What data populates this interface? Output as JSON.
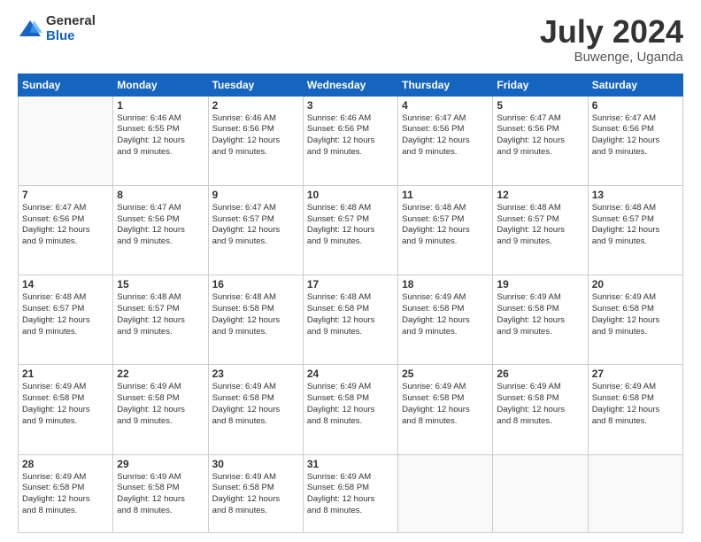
{
  "logo": {
    "general": "General",
    "blue": "Blue"
  },
  "header": {
    "month_year": "July 2024",
    "location": "Buwenge, Uganda"
  },
  "weekdays": [
    "Sunday",
    "Monday",
    "Tuesday",
    "Wednesday",
    "Thursday",
    "Friday",
    "Saturday"
  ],
  "weeks": [
    [
      {
        "day": "",
        "text": ""
      },
      {
        "day": "1",
        "text": "Sunrise: 6:46 AM\nSunset: 6:55 PM\nDaylight: 12 hours\nand 9 minutes."
      },
      {
        "day": "2",
        "text": "Sunrise: 6:46 AM\nSunset: 6:56 PM\nDaylight: 12 hours\nand 9 minutes."
      },
      {
        "day": "3",
        "text": "Sunrise: 6:46 AM\nSunset: 6:56 PM\nDaylight: 12 hours\nand 9 minutes."
      },
      {
        "day": "4",
        "text": "Sunrise: 6:47 AM\nSunset: 6:56 PM\nDaylight: 12 hours\nand 9 minutes."
      },
      {
        "day": "5",
        "text": "Sunrise: 6:47 AM\nSunset: 6:56 PM\nDaylight: 12 hours\nand 9 minutes."
      },
      {
        "day": "6",
        "text": "Sunrise: 6:47 AM\nSunset: 6:56 PM\nDaylight: 12 hours\nand 9 minutes."
      }
    ],
    [
      {
        "day": "7",
        "text": "Sunrise: 6:47 AM\nSunset: 6:56 PM\nDaylight: 12 hours\nand 9 minutes."
      },
      {
        "day": "8",
        "text": "Sunrise: 6:47 AM\nSunset: 6:56 PM\nDaylight: 12 hours\nand 9 minutes."
      },
      {
        "day": "9",
        "text": "Sunrise: 6:47 AM\nSunset: 6:57 PM\nDaylight: 12 hours\nand 9 minutes."
      },
      {
        "day": "10",
        "text": "Sunrise: 6:48 AM\nSunset: 6:57 PM\nDaylight: 12 hours\nand 9 minutes."
      },
      {
        "day": "11",
        "text": "Sunrise: 6:48 AM\nSunset: 6:57 PM\nDaylight: 12 hours\nand 9 minutes."
      },
      {
        "day": "12",
        "text": "Sunrise: 6:48 AM\nSunset: 6:57 PM\nDaylight: 12 hours\nand 9 minutes."
      },
      {
        "day": "13",
        "text": "Sunrise: 6:48 AM\nSunset: 6:57 PM\nDaylight: 12 hours\nand 9 minutes."
      }
    ],
    [
      {
        "day": "14",
        "text": "Sunrise: 6:48 AM\nSunset: 6:57 PM\nDaylight: 12 hours\nand 9 minutes."
      },
      {
        "day": "15",
        "text": "Sunrise: 6:48 AM\nSunset: 6:57 PM\nDaylight: 12 hours\nand 9 minutes."
      },
      {
        "day": "16",
        "text": "Sunrise: 6:48 AM\nSunset: 6:58 PM\nDaylight: 12 hours\nand 9 minutes."
      },
      {
        "day": "17",
        "text": "Sunrise: 6:48 AM\nSunset: 6:58 PM\nDaylight: 12 hours\nand 9 minutes."
      },
      {
        "day": "18",
        "text": "Sunrise: 6:49 AM\nSunset: 6:58 PM\nDaylight: 12 hours\nand 9 minutes."
      },
      {
        "day": "19",
        "text": "Sunrise: 6:49 AM\nSunset: 6:58 PM\nDaylight: 12 hours\nand 9 minutes."
      },
      {
        "day": "20",
        "text": "Sunrise: 6:49 AM\nSunset: 6:58 PM\nDaylight: 12 hours\nand 9 minutes."
      }
    ],
    [
      {
        "day": "21",
        "text": "Sunrise: 6:49 AM\nSunset: 6:58 PM\nDaylight: 12 hours\nand 9 minutes."
      },
      {
        "day": "22",
        "text": "Sunrise: 6:49 AM\nSunset: 6:58 PM\nDaylight: 12 hours\nand 9 minutes."
      },
      {
        "day": "23",
        "text": "Sunrise: 6:49 AM\nSunset: 6:58 PM\nDaylight: 12 hours\nand 8 minutes."
      },
      {
        "day": "24",
        "text": "Sunrise: 6:49 AM\nSunset: 6:58 PM\nDaylight: 12 hours\nand 8 minutes."
      },
      {
        "day": "25",
        "text": "Sunrise: 6:49 AM\nSunset: 6:58 PM\nDaylight: 12 hours\nand 8 minutes."
      },
      {
        "day": "26",
        "text": "Sunrise: 6:49 AM\nSunset: 6:58 PM\nDaylight: 12 hours\nand 8 minutes."
      },
      {
        "day": "27",
        "text": "Sunrise: 6:49 AM\nSunset: 6:58 PM\nDaylight: 12 hours\nand 8 minutes."
      }
    ],
    [
      {
        "day": "28",
        "text": "Sunrise: 6:49 AM\nSunset: 6:58 PM\nDaylight: 12 hours\nand 8 minutes."
      },
      {
        "day": "29",
        "text": "Sunrise: 6:49 AM\nSunset: 6:58 PM\nDaylight: 12 hours\nand 8 minutes."
      },
      {
        "day": "30",
        "text": "Sunrise: 6:49 AM\nSunset: 6:58 PM\nDaylight: 12 hours\nand 8 minutes."
      },
      {
        "day": "31",
        "text": "Sunrise: 6:49 AM\nSunset: 6:58 PM\nDaylight: 12 hours\nand 8 minutes."
      },
      {
        "day": "",
        "text": ""
      },
      {
        "day": "",
        "text": ""
      },
      {
        "day": "",
        "text": ""
      }
    ]
  ]
}
